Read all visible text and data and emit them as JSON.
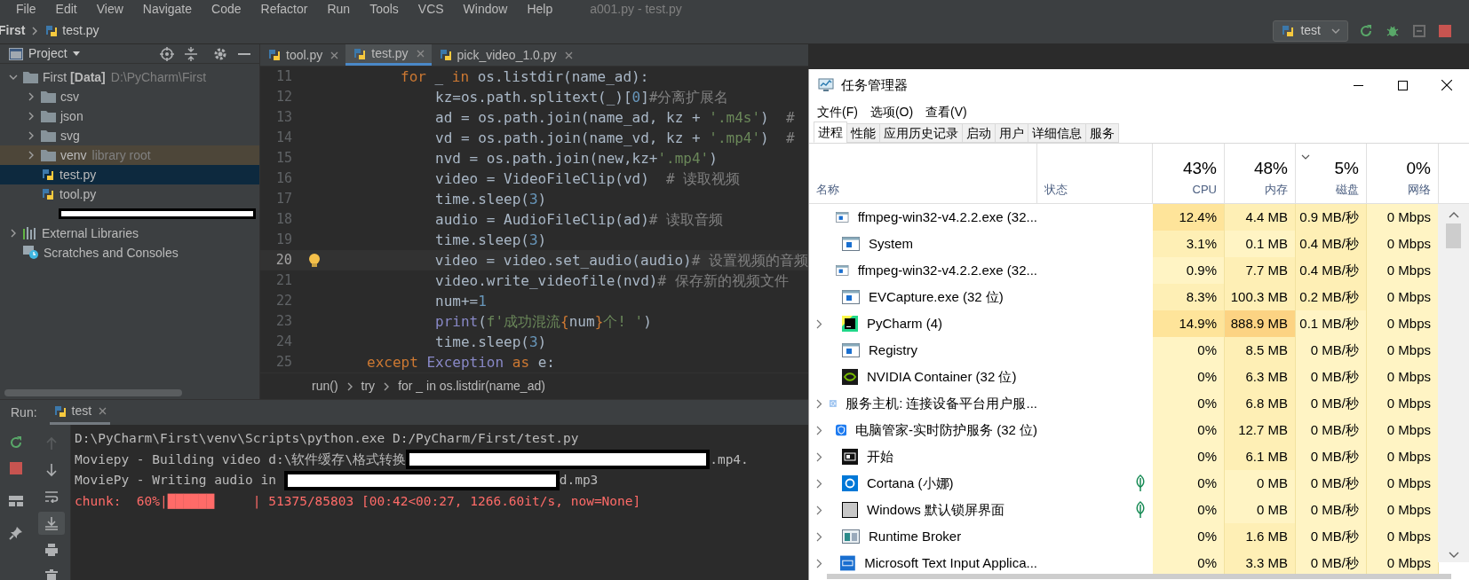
{
  "ide": {
    "menu": [
      "File",
      "Edit",
      "View",
      "Navigate",
      "Code",
      "Refactor",
      "Run",
      "Tools",
      "VCS",
      "Window",
      "Help"
    ],
    "window_title": "a001.py - test.py",
    "breadcrumb_nav": {
      "project": "First",
      "file": "test.py"
    },
    "run_config": "test",
    "project_panel": {
      "title": "Project",
      "tree": [
        {
          "kind": "folder",
          "label": "First **[Data]**",
          "hint": "D:\\PyCharm\\First",
          "expanded": true,
          "selected": false,
          "children": [
            {
              "kind": "folder",
              "label": "csv",
              "expanded": false,
              "selected": false
            },
            {
              "kind": "folder",
              "label": "json",
              "expanded": false,
              "selected": false
            },
            {
              "kind": "folder",
              "label": "svg",
              "expanded": false,
              "selected": false
            },
            {
              "kind": "library_folder",
              "label": "venv",
              "hint": "library root",
              "expanded": false,
              "selected": false
            },
            {
              "kind": "python",
              "label": "test.py",
              "selected": true
            },
            {
              "kind": "python",
              "label": "tool.py",
              "selected": false
            },
            {
              "kind": "redacted",
              "selected": false
            }
          ]
        },
        {
          "kind": "libraries",
          "label": "External Libraries",
          "expanded": false,
          "selected": false
        },
        {
          "kind": "scratches",
          "label": "Scratches and Consoles",
          "selected": false
        }
      ]
    },
    "editor_tabs": [
      {
        "label": "tool.py",
        "selected": false
      },
      {
        "label": "test.py",
        "selected": true
      },
      {
        "label": "pick_video_1.0.py",
        "selected": false
      }
    ],
    "code_lines": [
      {
        "number": "11",
        "kind": "loop",
        "current": false,
        "segments": [
          {
            "kind": "kw",
            "text": "for"
          },
          {
            "kind": "plain",
            "text": " _ "
          },
          {
            "kind": "kw",
            "text": "in"
          },
          {
            "kind": "plain",
            "text": " os.listdir(name_ad):"
          }
        ]
      },
      {
        "number": "12",
        "kind": "body",
        "current": false,
        "segments": [
          {
            "kind": "plain",
            "text": "kz=os.path.splitext(_)["
          },
          {
            "kind": "num",
            "text": "0"
          },
          {
            "kind": "plain",
            "text": "]"
          },
          {
            "kind": "comment",
            "text": "#分离扩展名"
          }
        ]
      },
      {
        "number": "13",
        "kind": "body",
        "current": false,
        "segments": [
          {
            "kind": "plain",
            "text": "ad = os.path.join(name_ad, kz + "
          },
          {
            "kind": "str",
            "text": "'.m4s'"
          },
          {
            "kind": "plain",
            "text": ")  "
          },
          {
            "kind": "comment",
            "text": "#"
          }
        ]
      },
      {
        "number": "14",
        "kind": "body",
        "current": false,
        "segments": [
          {
            "kind": "plain",
            "text": "vd = os.path.join(name_vd, kz + "
          },
          {
            "kind": "str",
            "text": "'.mp4'"
          },
          {
            "kind": "plain",
            "text": ")  "
          },
          {
            "kind": "comment",
            "text": "#"
          }
        ]
      },
      {
        "number": "15",
        "kind": "body",
        "current": false,
        "segments": [
          {
            "kind": "plain",
            "text": "nvd = os.path.join(new,kz+"
          },
          {
            "kind": "str",
            "text": "'.mp4'"
          },
          {
            "kind": "plain",
            "text": ")"
          }
        ]
      },
      {
        "number": "16",
        "kind": "body",
        "current": false,
        "segments": [
          {
            "kind": "plain",
            "text": "video = VideoFileClip(vd)  "
          },
          {
            "kind": "comment",
            "text": "# 读取视频"
          }
        ]
      },
      {
        "number": "17",
        "kind": "body",
        "current": false,
        "segments": [
          {
            "kind": "plain",
            "text": "time.sleep("
          },
          {
            "kind": "num",
            "text": "3"
          },
          {
            "kind": "plain",
            "text": ")"
          }
        ]
      },
      {
        "number": "18",
        "kind": "body",
        "current": false,
        "segments": [
          {
            "kind": "plain",
            "text": "audio = AudioFileClip(ad)"
          },
          {
            "kind": "comment",
            "text": "# 读取音频"
          }
        ]
      },
      {
        "number": "19",
        "kind": "body",
        "current": false,
        "segments": [
          {
            "kind": "plain",
            "text": "time.sleep("
          },
          {
            "kind": "num",
            "text": "3"
          },
          {
            "kind": "plain",
            "text": ")"
          }
        ]
      },
      {
        "number": "20",
        "kind": "body",
        "current": true,
        "segments": [
          {
            "kind": "plain",
            "text": "video = video.set_audio(audio)"
          },
          {
            "kind": "comment",
            "text": "# 设置视频的音频"
          }
        ]
      },
      {
        "number": "21",
        "kind": "body",
        "current": false,
        "segments": [
          {
            "kind": "plain",
            "text": "video.write_videofile(nvd)"
          },
          {
            "kind": "comment",
            "text": "# 保存新的视频文件"
          }
        ]
      },
      {
        "number": "22",
        "kind": "body",
        "current": false,
        "segments": [
          {
            "kind": "plain",
            "text": "num+="
          },
          {
            "kind": "num",
            "text": "1"
          }
        ]
      },
      {
        "number": "23",
        "kind": "body",
        "current": false,
        "segments": [
          {
            "kind": "builtin",
            "text": "print"
          },
          {
            "kind": "plain",
            "text": "("
          },
          {
            "kind": "str",
            "text": "f'成功混流"
          },
          {
            "kind": "brace",
            "text": "{"
          },
          {
            "kind": "plain",
            "text": "num"
          },
          {
            "kind": "brace",
            "text": "}"
          },
          {
            "kind": "str",
            "text": "个! '"
          },
          {
            "kind": "plain",
            "text": ")"
          }
        ]
      },
      {
        "number": "24",
        "kind": "body",
        "current": false,
        "segments": [
          {
            "kind": "plain",
            "text": "time.sleep("
          },
          {
            "kind": "num",
            "text": "3"
          },
          {
            "kind": "plain",
            "text": ")"
          }
        ]
      },
      {
        "number": "25",
        "kind": "handler",
        "current": false,
        "segments": [
          {
            "kind": "kw",
            "text": "except"
          },
          {
            "kind": "builtin",
            "text": " Exception"
          },
          {
            "kind": "kw",
            "text": " as"
          },
          {
            "kind": "plain",
            "text": " e:"
          }
        ]
      }
    ],
    "breadcrumbs": [
      "run()",
      "try",
      "for _ in os.listdir(name_ad)"
    ],
    "run_panel": {
      "title": "Run:",
      "tab": {
        "label": "test",
        "selected": true
      },
      "tools": [
        {
          "kind": "up",
          "disabled": true,
          "on": false
        },
        {
          "kind": "down",
          "disabled": false,
          "on": false
        },
        {
          "kind": "wrap",
          "disabled": false,
          "on": false
        },
        {
          "kind": "scroll_end",
          "disabled": false,
          "on": true
        },
        {
          "kind": "print",
          "disabled": false,
          "on": false
        },
        {
          "kind": "trash",
          "disabled": false,
          "on": false
        }
      ],
      "console": [
        {
          "kind": "stdout",
          "segments": [
            {
              "kind": "text",
              "text": "D:\\PyCharm\\First\\venv\\Scripts\\python.exe D:/PyCharm/First/test.py"
            }
          ]
        },
        {
          "kind": "stdout",
          "segments": [
            {
              "kind": "text",
              "text": "Moviepy - Building video d:\\软件缓存\\格式转换"
            },
            {
              "kind": "redacted"
            },
            {
              "kind": "text",
              "text": ".mp4."
            }
          ]
        },
        {
          "kind": "stdout",
          "segments": [
            {
              "kind": "text",
              "text": "MoviePy - Writing audio in "
            },
            {
              "kind": "redacted"
            },
            {
              "kind": "text",
              "text": "d.mp3"
            }
          ]
        },
        {
          "kind": "stderr",
          "segments": [
            {
              "kind": "text",
              "text": "chunk:  60%|██████     | 51375/85803 [00:42<00:27, 1266.60it/s, now=None]"
            }
          ]
        }
      ]
    }
  },
  "task_manager": {
    "title": "任务管理器",
    "menu": [
      "文件(F)",
      "选项(O)",
      "查看(V)"
    ],
    "tabs": [
      {
        "label": "进程",
        "selected": true
      },
      {
        "label": "性能",
        "selected": false
      },
      {
        "label": "应用历史记录",
        "selected": false
      },
      {
        "label": "启动",
        "selected": false
      },
      {
        "label": "用户",
        "selected": false
      },
      {
        "label": "详细信息",
        "selected": false
      },
      {
        "label": "服务",
        "selected": false
      }
    ],
    "columns": [
      {
        "label": "名称"
      },
      {
        "label": "状态"
      },
      {
        "percent": "43%",
        "label": "CPU",
        "sorted": false
      },
      {
        "percent": "48%",
        "label": "内存",
        "sorted": false
      },
      {
        "percent": "5%",
        "label": "磁盘",
        "sorted": true
      },
      {
        "percent": "0%",
        "label": "网络",
        "sorted": false
      }
    ],
    "rows": [
      {
        "kind": "app",
        "name": "ffmpeg-win32-v4.2.2.exe (32...",
        "expandable": false,
        "leaf": false,
        "cpu": {
          "text": "12.4%",
          "color": "#fee49a"
        },
        "memory": {
          "text": "4.4 MB",
          "color": "#feefb5"
        },
        "disk": {
          "text": "0.9 MB/秒",
          "color": "#feefb5"
        },
        "network": {
          "text": "0 Mbps",
          "color": "#fff4c4"
        }
      },
      {
        "kind": "app",
        "name": "System",
        "expandable": false,
        "leaf": false,
        "cpu": {
          "text": "3.1%",
          "color": "#feefb5"
        },
        "memory": {
          "text": "0.1 MB",
          "color": "#fff4c4"
        },
        "disk": {
          "text": "0.4 MB/秒",
          "color": "#feefb5"
        },
        "network": {
          "text": "0 Mbps",
          "color": "#fff4c4"
        }
      },
      {
        "kind": "app",
        "name": "ffmpeg-win32-v4.2.2.exe (32...",
        "expandable": false,
        "leaf": false,
        "cpu": {
          "text": "0.9%",
          "color": "#fff4c4"
        },
        "memory": {
          "text": "7.7 MB",
          "color": "#feefb5"
        },
        "disk": {
          "text": "0.4 MB/秒",
          "color": "#feefb5"
        },
        "network": {
          "text": "0 Mbps",
          "color": "#fff4c4"
        }
      },
      {
        "kind": "app",
        "name": "EVCapture.exe (32 位)",
        "expandable": false,
        "leaf": false,
        "cpu": {
          "text": "8.3%",
          "color": "#feefb5"
        },
        "memory": {
          "text": "100.3 MB",
          "color": "#feefb5"
        },
        "disk": {
          "text": "0.2 MB/秒",
          "color": "#feefb5"
        },
        "network": {
          "text": "0 Mbps",
          "color": "#fff4c4"
        }
      },
      {
        "kind": "pycharm",
        "name": "PyCharm (4)",
        "expandable": true,
        "leaf": false,
        "cpu": {
          "text": "14.9%",
          "color": "#fee49a"
        },
        "memory": {
          "text": "888.9 MB",
          "color": "#fcd383"
        },
        "disk": {
          "text": "0.1 MB/秒",
          "color": "#fff4c4"
        },
        "network": {
          "text": "0 Mbps",
          "color": "#fff4c4"
        }
      },
      {
        "kind": "app",
        "name": "Registry",
        "expandable": false,
        "leaf": false,
        "cpu": {
          "text": "0%",
          "color": "#fff4c4"
        },
        "memory": {
          "text": "8.5 MB",
          "color": "#feefb5"
        },
        "disk": {
          "text": "0 MB/秒",
          "color": "#fff4c4"
        },
        "network": {
          "text": "0 Mbps",
          "color": "#fff4c4"
        }
      },
      {
        "kind": "nvidia",
        "name": "NVIDIA Container (32 位)",
        "expandable": false,
        "leaf": false,
        "cpu": {
          "text": "0%",
          "color": "#fff4c4"
        },
        "memory": {
          "text": "6.3 MB",
          "color": "#feefb5"
        },
        "disk": {
          "text": "0 MB/秒",
          "color": "#fff4c4"
        },
        "network": {
          "text": "0 Mbps",
          "color": "#fff4c4"
        }
      },
      {
        "kind": "gear",
        "name": "服务主机: 连接设备平台用户服...",
        "expandable": true,
        "leaf": false,
        "cpu": {
          "text": "0%",
          "color": "#fff4c4"
        },
        "memory": {
          "text": "6.8 MB",
          "color": "#feefb5"
        },
        "disk": {
          "text": "0 MB/秒",
          "color": "#fff4c4"
        },
        "network": {
          "text": "0 Mbps",
          "color": "#fff4c4"
        }
      },
      {
        "kind": "shield",
        "name": "电脑管家-实时防护服务 (32 位)",
        "expandable": true,
        "leaf": false,
        "cpu": {
          "text": "0%",
          "color": "#fff4c4"
        },
        "memory": {
          "text": "12.7 MB",
          "color": "#feefb5"
        },
        "disk": {
          "text": "0 MB/秒",
          "color": "#fff4c4"
        },
        "network": {
          "text": "0 Mbps",
          "color": "#fff4c4"
        }
      },
      {
        "kind": "start",
        "name": "开始",
        "expandable": true,
        "leaf": false,
        "cpu": {
          "text": "0%",
          "color": "#fff4c4"
        },
        "memory": {
          "text": "6.1 MB",
          "color": "#feefb5"
        },
        "disk": {
          "text": "0 MB/秒",
          "color": "#fff4c4"
        },
        "network": {
          "text": "0 Mbps",
          "color": "#fff4c4"
        }
      },
      {
        "kind": "cortana",
        "name": "Cortana (小娜)",
        "expandable": true,
        "leaf": true,
        "cpu": {
          "text": "0%",
          "color": "#fff4c4"
        },
        "memory": {
          "text": "0 MB",
          "color": "#fff4c4"
        },
        "disk": {
          "text": "0 MB/秒",
          "color": "#fff4c4"
        },
        "network": {
          "text": "0 Mbps",
          "color": "#fff4c4"
        }
      },
      {
        "kind": "lock",
        "name": "Windows 默认锁屏界面",
        "expandable": true,
        "leaf": true,
        "cpu": {
          "text": "0%",
          "color": "#fff4c4"
        },
        "memory": {
          "text": "0 MB",
          "color": "#fff4c4"
        },
        "disk": {
          "text": "0 MB/秒",
          "color": "#fff4c4"
        },
        "network": {
          "text": "0 Mbps",
          "color": "#fff4c4"
        }
      },
      {
        "kind": "runtime",
        "name": "Runtime Broker",
        "expandable": true,
        "leaf": false,
        "cpu": {
          "text": "0%",
          "color": "#fff4c4"
        },
        "memory": {
          "text": "1.6 MB",
          "color": "#feefb5"
        },
        "disk": {
          "text": "0 MB/秒",
          "color": "#fff4c4"
        },
        "network": {
          "text": "0 Mbps",
          "color": "#fff4c4"
        }
      },
      {
        "kind": "keyboard",
        "name": "Microsoft Text Input Applica...",
        "expandable": true,
        "leaf": false,
        "cpu": {
          "text": "0%",
          "color": "#fff4c4"
        },
        "memory": {
          "text": "3.3 MB",
          "color": "#feefb5"
        },
        "disk": {
          "text": "0 MB/秒",
          "color": "#fff4c4"
        },
        "network": {
          "text": "0 Mbps",
          "color": "#fff4c4"
        }
      }
    ]
  }
}
